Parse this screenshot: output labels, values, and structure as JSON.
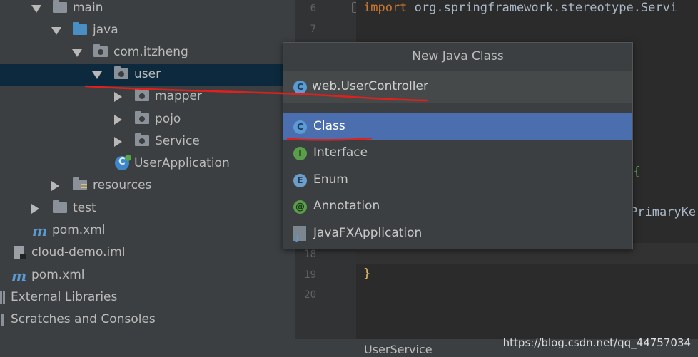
{
  "tree": {
    "items": [
      {
        "label": "main"
      },
      {
        "label": "java"
      },
      {
        "label": "com.itzheng"
      },
      {
        "label": "user"
      },
      {
        "label": "mapper"
      },
      {
        "label": "pojo"
      },
      {
        "label": "Service"
      },
      {
        "label": "UserApplication"
      },
      {
        "label": "resources"
      },
      {
        "label": "test"
      },
      {
        "label": "pom.xml"
      },
      {
        "label": "cloud-demo.iml"
      },
      {
        "label": "pom.xml"
      },
      {
        "label": "External Libraries"
      },
      {
        "label": "Scratches and Consoles"
      }
    ]
  },
  "editor": {
    "line_numbers": [
      "6",
      "7",
      "18",
      "19",
      "20"
    ],
    "code": {
      "import_kw": "import",
      "import_path": " org.springframework.stereotype.Servi",
      "brace_open": "{",
      "primary_key_fragment": "PrimaryKe",
      "brace_close": "}"
    },
    "tab_name": "UserService"
  },
  "dialog": {
    "title": "New Java Class",
    "name_value": "web.UserController",
    "kinds": [
      {
        "label": "Class",
        "icon": "class-icon"
      },
      {
        "label": "Interface",
        "icon": "interface-icon"
      },
      {
        "label": "Enum",
        "icon": "enum-icon"
      },
      {
        "label": "Annotation",
        "icon": "annotation-icon"
      },
      {
        "label": "JavaFXApplication",
        "icon": "javafx-icon"
      }
    ],
    "selected": "Class"
  },
  "icons": {
    "class_letter": "C",
    "interface_letter": "I",
    "enum_letter": "E",
    "annotation_letter": "@"
  },
  "watermark": "https://blog.csdn.net/qq_44757034",
  "colors": {
    "selection": "#4b6eaf",
    "tree_selection": "#0d293e",
    "annotation_red": "#e0201c"
  }
}
